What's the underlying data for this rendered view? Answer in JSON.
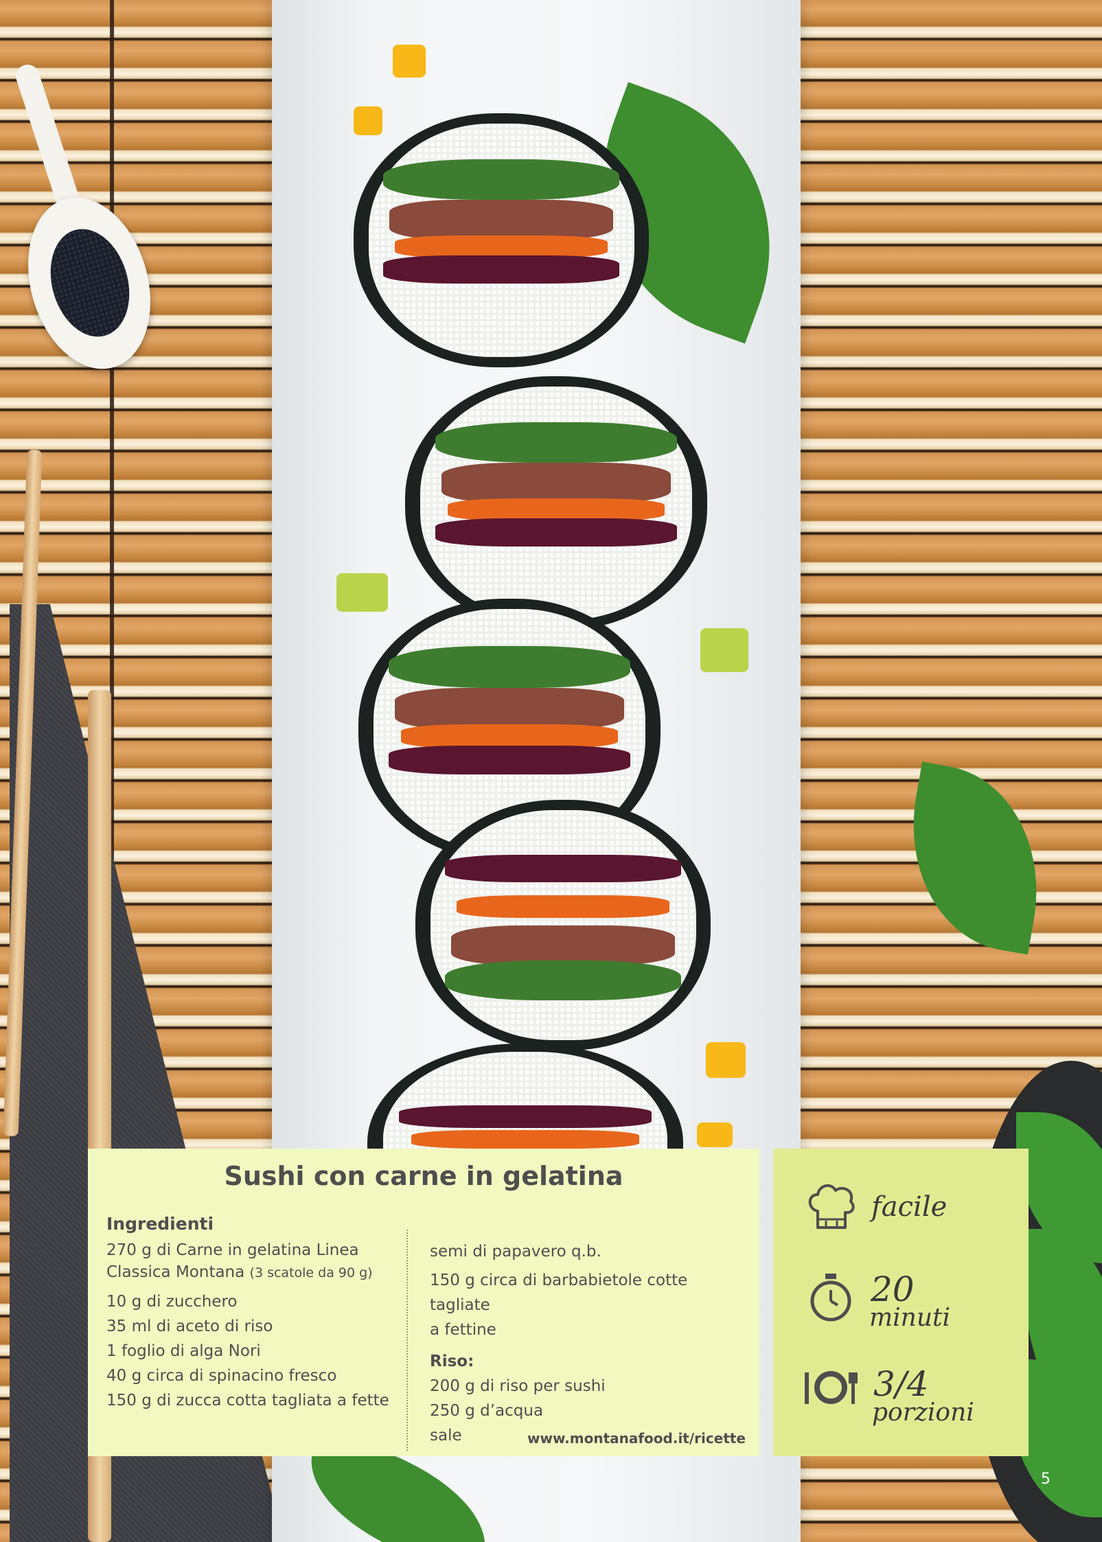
{
  "recipe": {
    "title": "Sushi con carne in gelatina",
    "ingredients_label": "Ingredienti",
    "ingredients_left": [
      {
        "text": "270 g di Carne in gelatina Linea",
        "note": ""
      },
      {
        "text": "Classica Montana",
        "note": "(3 scatole da 90 g)"
      },
      {
        "text": "10 g di zucchero",
        "note": ""
      },
      {
        "text": "35 ml di aceto di riso",
        "note": ""
      },
      {
        "text": "1 foglio di alga Nori",
        "note": ""
      },
      {
        "text": "40 g circa di spinacino fresco",
        "note": ""
      },
      {
        "text": "150 g di zucca cotta tagliata a fette",
        "note": ""
      }
    ],
    "ingredients_right": [
      "semi di papavero q.b.",
      "150 g circa di barbabietole cotte tagliate",
      "a fettine"
    ],
    "rice_label": "Riso:",
    "rice_ingredients": [
      "200 g di riso per sushi",
      "250 g d’acqua",
      "sale"
    ],
    "url": "www.montanafood.it/ricette"
  },
  "info": {
    "difficulty": "facile",
    "time_value": "20",
    "time_unit": "minuti",
    "servings_value": "3/4",
    "servings_unit": "porzioni",
    "icons": [
      "chef-hat-icon",
      "stopwatch-icon",
      "cutlery-plate-icon"
    ]
  },
  "page_number": "5",
  "colors": {
    "card_bg": "#f1f9c0",
    "side_bg": "#e0eb91",
    "text": "#4e4e4e"
  }
}
